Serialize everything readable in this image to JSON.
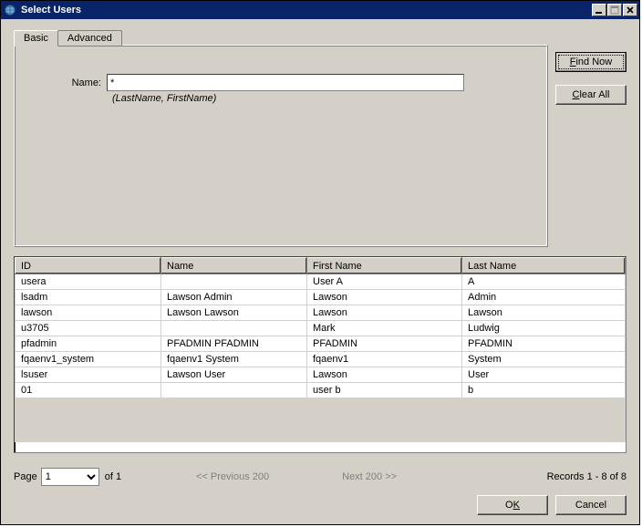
{
  "window": {
    "title": "Select Users"
  },
  "tabs": {
    "basic": "Basic",
    "advanced": "Advanced"
  },
  "search": {
    "name_label": "Name:",
    "name_value": "*",
    "name_hint": "(LastName, FirstName)"
  },
  "buttons": {
    "find_now": "Find Now",
    "clear_all": "Clear All",
    "ok": "OK",
    "cancel": "Cancel"
  },
  "columns": {
    "id": "ID",
    "name": "Name",
    "first_name": "First Name",
    "last_name": "Last Name"
  },
  "rows": [
    {
      "id": "usera",
      "name": "",
      "first_name": "User A",
      "last_name": "A"
    },
    {
      "id": "lsadm",
      "name": "Lawson Admin",
      "first_name": "Lawson",
      "last_name": "Admin"
    },
    {
      "id": "lawson",
      "name": "Lawson Lawson",
      "first_name": "Lawson",
      "last_name": "Lawson"
    },
    {
      "id": "u3705",
      "name": "",
      "first_name": "Mark",
      "last_name": "Ludwig"
    },
    {
      "id": "pfadmin",
      "name": "PFADMIN PFADMIN",
      "first_name": "PFADMIN",
      "last_name": "PFADMIN"
    },
    {
      "id": "fqaenv1_system",
      "name": "fqaenv1 System",
      "first_name": "fqaenv1",
      "last_name": "System"
    },
    {
      "id": "lsuser",
      "name": "Lawson User",
      "first_name": "Lawson",
      "last_name": "User"
    },
    {
      "id": "01",
      "name": "",
      "first_name": "user b",
      "last_name": "b"
    }
  ],
  "pager": {
    "page_label": "Page",
    "page_value": "1",
    "of_label": "of",
    "total_pages": "1",
    "prev": "<< Previous 200",
    "next": "Next 200 >>",
    "records": "Records 1 - 8 of 8"
  }
}
